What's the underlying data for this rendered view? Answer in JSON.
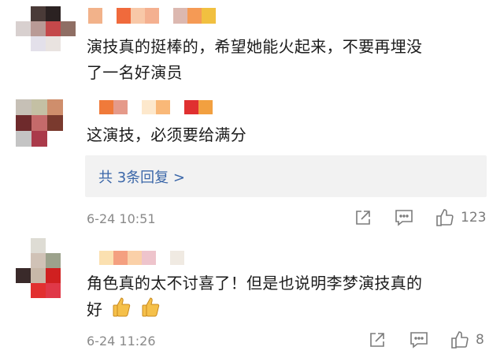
{
  "comments": [
    {
      "text_line1": "演技真的挺棒的，希望她能火起来，不要再埋没",
      "text_line2": "了一名好演员"
    },
    {
      "text": "这演技，必须要给满分",
      "replies_label": "共 3条回复 >",
      "date": "6-24",
      "time": "10:51",
      "like_count": "123"
    },
    {
      "text_line1": "角色真的太不讨喜了！但是也说明李梦演技真的",
      "text_line2": "好",
      "emoji": [
        "thumbs-up",
        "thumbs-up"
      ],
      "date": "6-24",
      "time": "11:26",
      "like_count": "8"
    }
  ],
  "colors": {
    "link": "#3a66a8",
    "meta": "#8a8a8a",
    "reply_bg": "#f2f2f2"
  }
}
